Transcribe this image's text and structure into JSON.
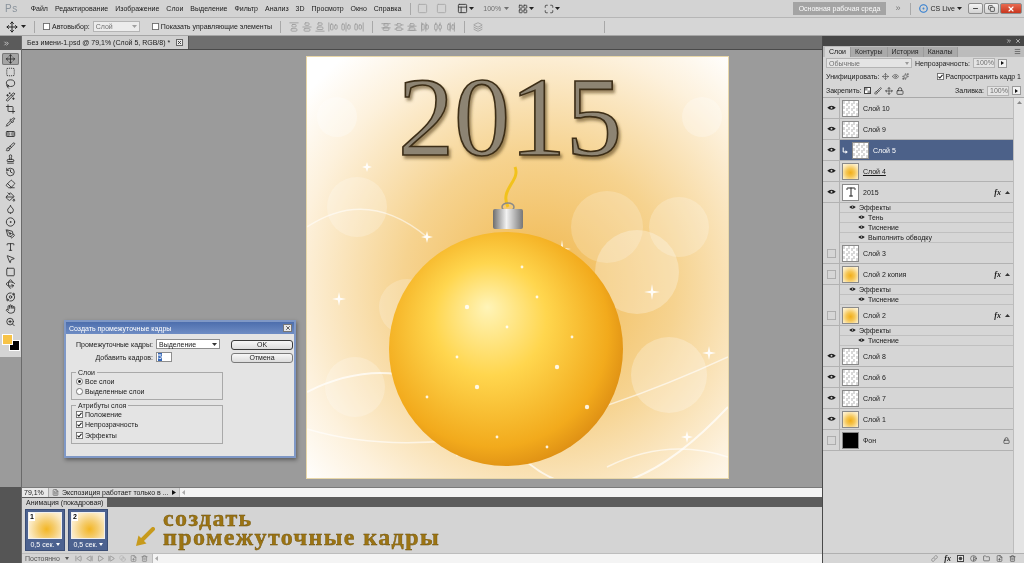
{
  "menu_bar": {
    "logo": "Ps",
    "items": [
      "Файл",
      "Редактирование",
      "Изображение",
      "Слои",
      "Выделение",
      "Фильтр",
      "Анализ",
      "3D",
      "Просмотр",
      "Окно",
      "Справка"
    ],
    "zoom": {
      "value": "100%",
      "disabled": true
    },
    "workspace": "Основная рабочая среда",
    "overflow": "»",
    "cs_live": "CS Live"
  },
  "options_bar": {
    "auto_select": {
      "label": "Автовыбор:",
      "checked": false
    },
    "auto_select_target": {
      "value": "Слой",
      "disabled": true
    },
    "show_controls": {
      "label": "Показать управляющие элементы",
      "checked": false
    }
  },
  "tools": [
    {
      "kind": "move",
      "selected": true
    },
    {
      "kind": "marquee",
      "selected": false
    },
    {
      "kind": "lasso",
      "selected": false
    },
    {
      "kind": "wand",
      "selected": false
    },
    {
      "kind": "crop",
      "selected": false
    },
    {
      "kind": "eyedropper",
      "selected": false
    },
    {
      "kind": "healing",
      "selected": false
    },
    {
      "kind": "brush",
      "selected": false
    },
    {
      "kind": "stamp",
      "selected": false
    },
    {
      "kind": "history",
      "selected": false
    },
    {
      "kind": "eraser",
      "selected": false
    },
    {
      "kind": "bucket",
      "selected": false
    },
    {
      "kind": "blur",
      "selected": false
    },
    {
      "kind": "dodge",
      "selected": false
    },
    {
      "kind": "pen",
      "selected": false
    },
    {
      "kind": "type",
      "selected": false
    },
    {
      "kind": "pathselect",
      "selected": false
    },
    {
      "kind": "shape",
      "selected": false
    },
    {
      "kind": "rotate3d",
      "selected": false
    },
    {
      "kind": "orbit",
      "selected": false
    },
    {
      "kind": "hand",
      "selected": false
    },
    {
      "kind": "zoom",
      "selected": false
    }
  ],
  "document": {
    "tab_title": "Без имени-1.psd @ 79,1% (Слой 5, RGB/8) *",
    "canvas_text": "2015"
  },
  "status_bar": {
    "zoom": "79,1%",
    "info": "Экспозиция работает только в ..."
  },
  "animation_panel": {
    "tab": "Анимация (покадровая)",
    "frames": [
      {
        "number": "1",
        "delay": "0,5 сек.",
        "selected": true
      },
      {
        "number": "2",
        "delay": "0,5 сек.",
        "selected": true
      }
    ],
    "loop": "Постоянно",
    "tween_button": {
      "disabled": true
    }
  },
  "annotation": {
    "lines": [
      "создать",
      "промежуточные кадры"
    ]
  },
  "dialog": {
    "title": "Создать промежуточные кадры",
    "tween_with": {
      "label": "Промежуточные кадры:",
      "value": "Выделение"
    },
    "frames_to_add": {
      "label": "Добавить кадров:",
      "value": "5"
    },
    "buttons": [
      "OK",
      "Отмена"
    ],
    "layers_group": {
      "title": "Слои",
      "options": [
        {
          "label": "Все слои",
          "selected": true
        },
        {
          "label": "Выделенные слои",
          "selected": false
        }
      ]
    },
    "attributes_group": {
      "title": "Атрибуты слоя",
      "options": [
        {
          "label": "Положение",
          "checked": true
        },
        {
          "label": "Непрозрачность",
          "checked": true
        },
        {
          "label": "Эффекты",
          "checked": true
        }
      ]
    }
  },
  "layers_panel": {
    "tabs": [
      {
        "label": "Слои",
        "selected": true
      },
      {
        "label": "Контуры",
        "selected": false
      },
      {
        "label": "История",
        "selected": false
      },
      {
        "label": "Каналы",
        "selected": false
      }
    ],
    "blend_mode": {
      "value": "Обычные",
      "disabled": true
    },
    "opacity": {
      "label": "Непрозрачность:",
      "value": "100%",
      "disabled": true
    },
    "unify_label": "Унифицировать:",
    "propagate": {
      "label": "Распространить кадр 1",
      "checked": true
    },
    "lock_label": "Закрепить:",
    "fill": {
      "label": "Заливка:",
      "value": "100%",
      "disabled": true
    },
    "layers": [
      {
        "name": "Слой 10",
        "kind": "transparent",
        "visible": true,
        "selected": false,
        "clipped": false,
        "underlined": false,
        "locked": false
      },
      {
        "name": "Слой 9",
        "kind": "transparent",
        "visible": true,
        "selected": false,
        "clipped": false,
        "underlined": false,
        "locked": false
      },
      {
        "name": "Слой 5",
        "kind": "transparent",
        "visible": true,
        "selected": true,
        "clipped": true,
        "underlined": false,
        "locked": false
      },
      {
        "name": "Слой 4",
        "kind": "image",
        "visible": true,
        "selected": false,
        "clipped": false,
        "underlined": true,
        "locked": false
      },
      {
        "name": "2015",
        "kind": "text",
        "visible": true,
        "selected": false,
        "clipped": false,
        "underlined": false,
        "locked": false,
        "effects_badge": "fx",
        "expanded": true,
        "children": [
          {
            "name": "Эффекты",
            "visible": true,
            "children": [
              {
                "name": "Тень",
                "visible": true
              },
              {
                "name": "Тиснение",
                "visible": true
              },
              {
                "name": "Выполнить обводку",
                "visible": true
              }
            ]
          }
        ]
      },
      {
        "name": "Слой 3",
        "kind": "transparent",
        "visible": false,
        "selected": false,
        "clipped": false,
        "underlined": false,
        "locked": false
      },
      {
        "name": "Слой 2 копия",
        "kind": "image",
        "visible": false,
        "selected": false,
        "clipped": false,
        "underlined": false,
        "locked": false,
        "effects_badge": "fx",
        "expanded": true,
        "children": [
          {
            "name": "Эффекты",
            "visible": true,
            "children": [
              {
                "name": "Тиснение",
                "visible": true
              }
            ]
          }
        ]
      },
      {
        "name": "Слой 2",
        "kind": "image",
        "visible": false,
        "selected": false,
        "clipped": false,
        "underlined": false,
        "locked": false,
        "effects_badge": "fx",
        "expanded": true,
        "children": [
          {
            "name": "Эффекты",
            "visible": true,
            "children": [
              {
                "name": "Тиснение",
                "visible": true
              }
            ]
          }
        ]
      },
      {
        "name": "Слой 8",
        "kind": "transparent",
        "visible": true,
        "selected": false,
        "clipped": false,
        "underlined": false,
        "locked": false
      },
      {
        "name": "Слой 6",
        "kind": "transparent",
        "visible": true,
        "selected": false,
        "clipped": false,
        "underlined": false,
        "locked": false
      },
      {
        "name": "Слой 7",
        "kind": "transparent",
        "visible": true,
        "selected": false,
        "clipped": false,
        "underlined": false,
        "locked": false
      },
      {
        "name": "Слой 1",
        "kind": "image",
        "visible": true,
        "selected": false,
        "clipped": false,
        "underlined": false,
        "locked": false
      },
      {
        "name": "Фон",
        "kind": "black",
        "visible": false,
        "selected": false,
        "clipped": false,
        "underlined": false,
        "locked": true
      }
    ],
    "footer_effects": "fx"
  }
}
